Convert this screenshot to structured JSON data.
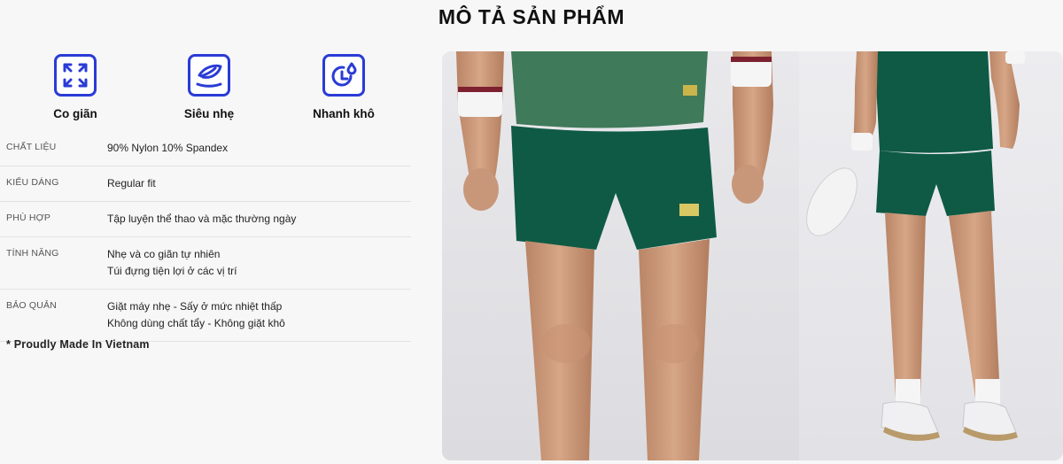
{
  "title": "MÔ TẢ SẢN PHẨM",
  "features": [
    {
      "label": "Co giãn",
      "icon": "expand-icon"
    },
    {
      "label": "Siêu nhẹ",
      "icon": "feather-light-icon"
    },
    {
      "label": "Nhanh khô",
      "icon": "quick-dry-timer-icon"
    }
  ],
  "specs": [
    {
      "key": "CHẤT LIỆU",
      "lines": [
        "90% Nylon 10% Spandex"
      ]
    },
    {
      "key": "KIỂU DÁNG",
      "lines": [
        "Regular fit"
      ]
    },
    {
      "key": "PHÙ HỢP",
      "lines": [
        "Tập luyện thể thao và mặc thường ngày"
      ]
    },
    {
      "key": "TÍNH NĂNG",
      "lines": [
        "Nhẹ và co giãn tự nhiên",
        "Túi đựng tiện lợi ở các vị trí"
      ]
    },
    {
      "key": "BẢO QUẢN",
      "lines": [
        "Giặt máy nhẹ - Sấy ở mức nhiệt thấp",
        "Không dùng chất tẩy - Không giặt khô"
      ]
    }
  ],
  "note": "* Proudly Made In Vietnam",
  "colors": {
    "accent": "#2a3bd6",
    "shorts": "#0f5a44",
    "shirt": "#3f7a5a"
  }
}
